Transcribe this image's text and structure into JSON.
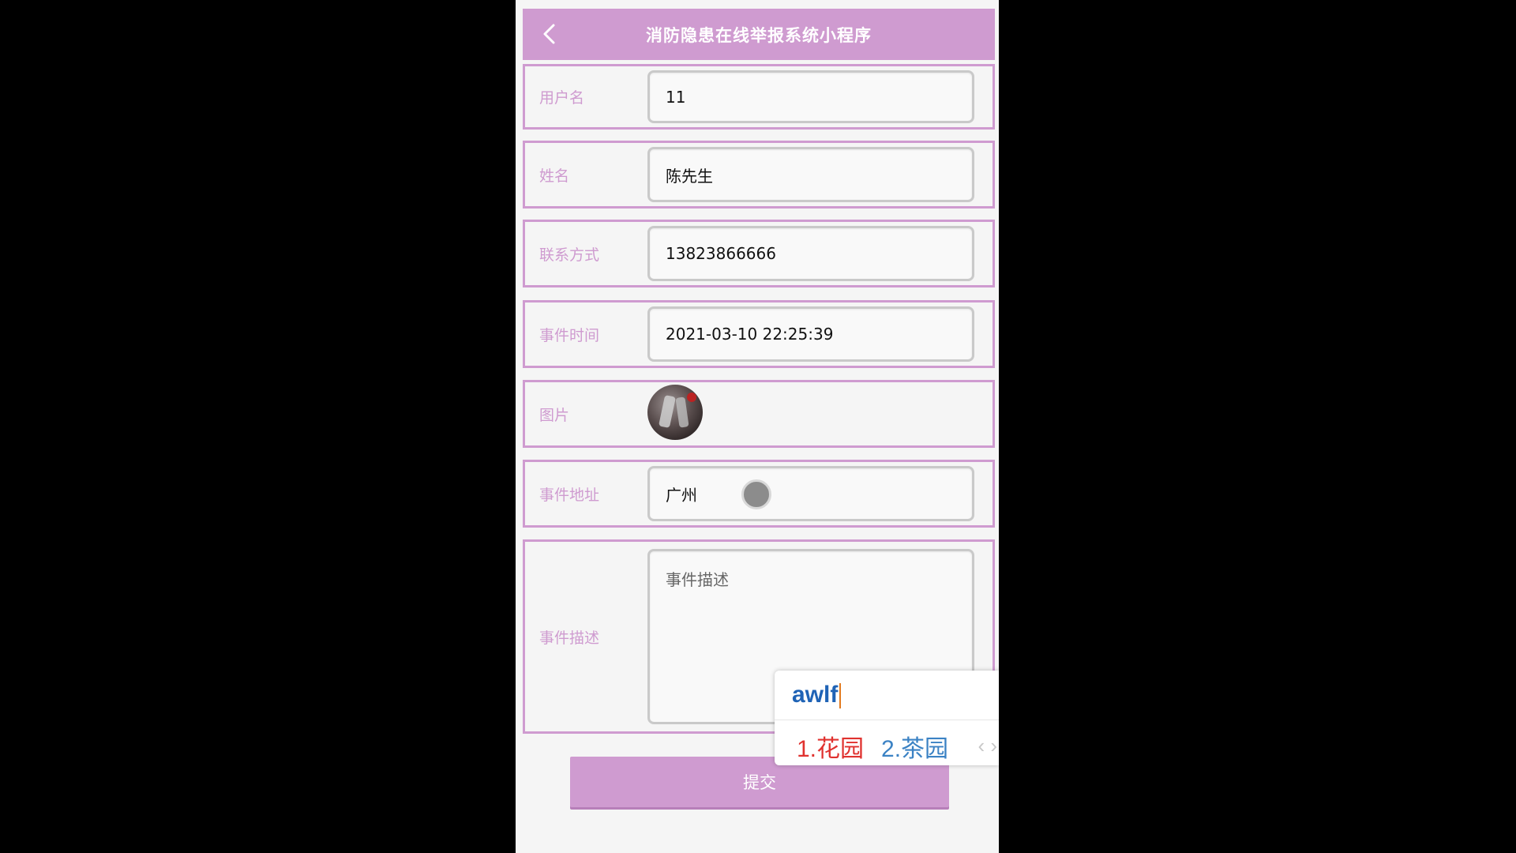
{
  "header": {
    "title": "消防隐患在线举报系统小程序"
  },
  "form": {
    "username": {
      "label": "用户名",
      "value": "11"
    },
    "name": {
      "label": "姓名",
      "value": "陈先生"
    },
    "contact": {
      "label": "联系方式",
      "value": "13823866666"
    },
    "event_time": {
      "label": "事件时间",
      "value": "2021-03-10 22:25:39"
    },
    "image": {
      "label": "图片"
    },
    "address": {
      "label": "事件地址",
      "value": "广州"
    },
    "description": {
      "label": "事件描述",
      "placeholder": "事件描述"
    }
  },
  "submit_label": "提交",
  "ime": {
    "composition": "awlf",
    "candidate1": "1.花园",
    "candidate2": "2.茶园",
    "nav": "‹ ›"
  },
  "colors": {
    "accent": "#cf9bd0",
    "ime_composition": "#1f63b6",
    "ime_candidate_selected": "#e0322f",
    "ime_candidate": "#3b82c4"
  }
}
